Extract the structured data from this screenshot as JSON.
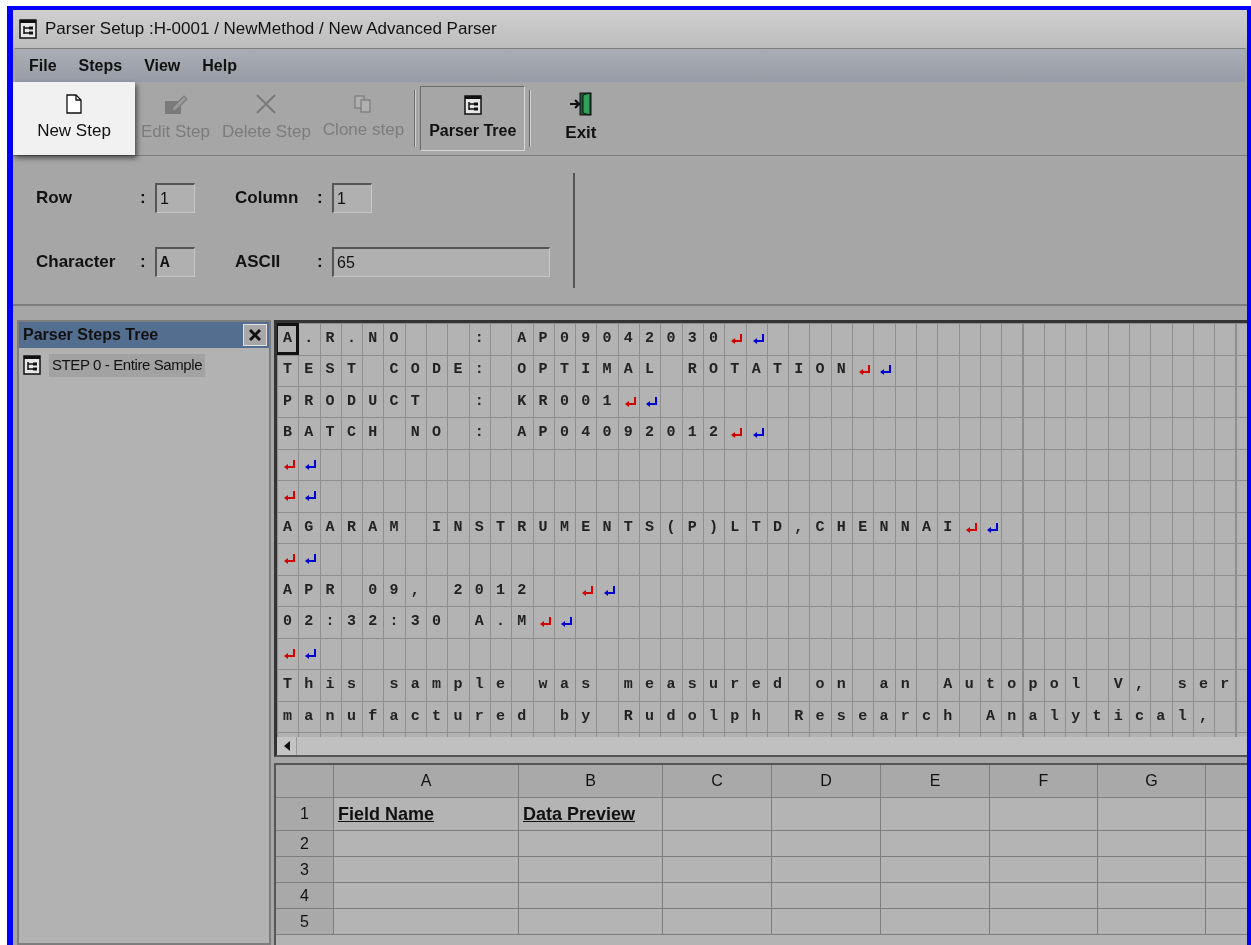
{
  "window": {
    "title": "Parser Setup :H-0001 / NewMethod / New Advanced Parser"
  },
  "menu": [
    "File",
    "Steps",
    "View",
    "Help"
  ],
  "toolbar": [
    {
      "kind": "new",
      "label": "New Step",
      "disabled": false,
      "highlighted": true,
      "pressed": false
    },
    {
      "kind": "edit",
      "label": "Edit Step",
      "disabled": true,
      "highlighted": false,
      "pressed": false
    },
    {
      "kind": "delete",
      "label": "Delete Step",
      "disabled": true,
      "highlighted": false,
      "pressed": false
    },
    {
      "kind": "clone",
      "label": "Clone step",
      "disabled": true,
      "highlighted": false,
      "pressed": false
    },
    {
      "kind": "separator"
    },
    {
      "kind": "tree",
      "label": "Parser Tree",
      "disabled": false,
      "highlighted": false,
      "pressed": true
    },
    {
      "kind": "separator"
    },
    {
      "kind": "exit",
      "label": "Exit",
      "disabled": false,
      "highlighted": false,
      "pressed": false
    }
  ],
  "position": [
    {
      "label": "Row",
      "sep": ":",
      "value": "1"
    },
    {
      "label": "Column",
      "sep": ":",
      "value": "1"
    },
    {
      "label": "Character",
      "sep": ":",
      "value": "A"
    },
    {
      "label": "ASCII",
      "sep": ":",
      "value": "65"
    }
  ],
  "tree": {
    "title": "Parser Steps Tree",
    "items": [
      {
        "label": "STEP 0 - Entire Sample",
        "selected": true
      }
    ]
  },
  "sample": [
    {
      "text": "A.R.NO   : AP09042030",
      "cr": true,
      "lf": true
    },
    {
      "text": "TEST CODE: OPTIMAL ROTATION",
      "cr": true,
      "lf": true
    },
    {
      "text": "PRODUCT  : KR001",
      "cr": true,
      "lf": true
    },
    {
      "text": "BATCH NO : AP04092012",
      "cr": true,
      "lf": true
    },
    {
      "cr": true,
      "lf": true
    },
    {
      "cr": true,
      "lf": true
    },
    {
      "text": "AGARAM INSTRUMENTS(P)LTD,CHENNAI",
      "cr": true,
      "lf": true
    },
    {
      "cr": true,
      "lf": true
    },
    {
      "text": "APR 09, 2012  ",
      "cr": true,
      "lf": true
    },
    {
      "text": "02:32:30 A.M",
      "cr": true,
      "lf": true
    },
    {
      "cr": true,
      "lf": true
    },
    {
      "text": "This sample was measured on an Autopol V, ser",
      "cr": false,
      "lf": false
    },
    {
      "text": "manufactured by Rudolph Research Analytical,",
      "cr": false,
      "lf": false
    }
  ],
  "sheet": {
    "columns": [
      "A",
      "B",
      "C",
      "D",
      "E",
      "F",
      "G"
    ],
    "rows": [
      {
        "header": "1",
        "cells": [
          "Field Name",
          "Data Preview"
        ]
      },
      {
        "header": "2"
      },
      {
        "header": "3"
      },
      {
        "header": "4"
      },
      {
        "header": "5"
      }
    ]
  }
}
